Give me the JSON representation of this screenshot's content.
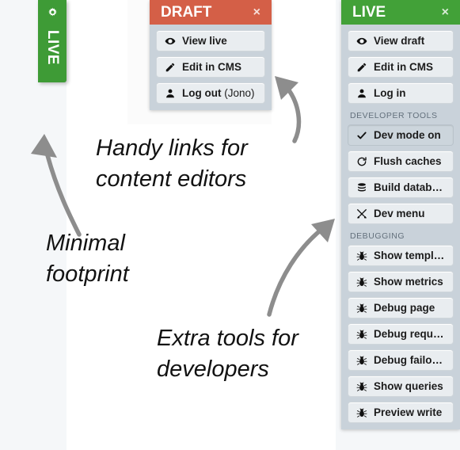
{
  "live_tab": {
    "label": "LIVE",
    "icon": "gear-icon",
    "color": "#3e9b36"
  },
  "draft_panel": {
    "title": "DRAFT",
    "close_label": "×",
    "accent": "#d45f47",
    "buttons": [
      {
        "label": "View live",
        "icon": "eye-icon"
      },
      {
        "label": "Edit in CMS",
        "icon": "pencil-icon"
      },
      {
        "label": "Log out ",
        "sub": "(Jono)",
        "icon": "user-icon"
      }
    ]
  },
  "live_panel": {
    "title": "LIVE",
    "close_label": "×",
    "accent": "#42a138",
    "buttons": [
      {
        "label": "View draft",
        "icon": "eye-icon"
      },
      {
        "label": "Edit in CMS",
        "icon": "pencil-icon"
      },
      {
        "label": "Log in",
        "icon": "user-icon"
      }
    ],
    "sections": [
      {
        "heading": "DEVELOPER TOOLS",
        "buttons": [
          {
            "label": "Dev mode on",
            "icon": "check-icon",
            "active": true
          },
          {
            "label": "Flush caches",
            "icon": "refresh-icon"
          },
          {
            "label": "Build database",
            "icon": "database-icon"
          },
          {
            "label": "Dev menu",
            "icon": "tools-icon"
          }
        ]
      },
      {
        "heading": "DEBUGGING",
        "buttons": [
          {
            "label": "Show template",
            "icon": "bug-icon"
          },
          {
            "label": "Show metrics",
            "icon": "bug-icon"
          },
          {
            "label": "Debug page",
            "icon": "bug-icon"
          },
          {
            "label": "Debug request",
            "icon": "bug-icon"
          },
          {
            "label": "Debug failover",
            "icon": "bug-icon"
          },
          {
            "label": "Show queries",
            "icon": "bug-icon"
          },
          {
            "label": "Preview write",
            "icon": "bug-icon"
          }
        ]
      }
    ]
  },
  "annotations": {
    "handy": "Handy links for\ncontent editors",
    "minimal": "Minimal\nfootprint",
    "extra": "Extra tools for\ndevelopers"
  },
  "arrow_color": "#8d8d8d"
}
